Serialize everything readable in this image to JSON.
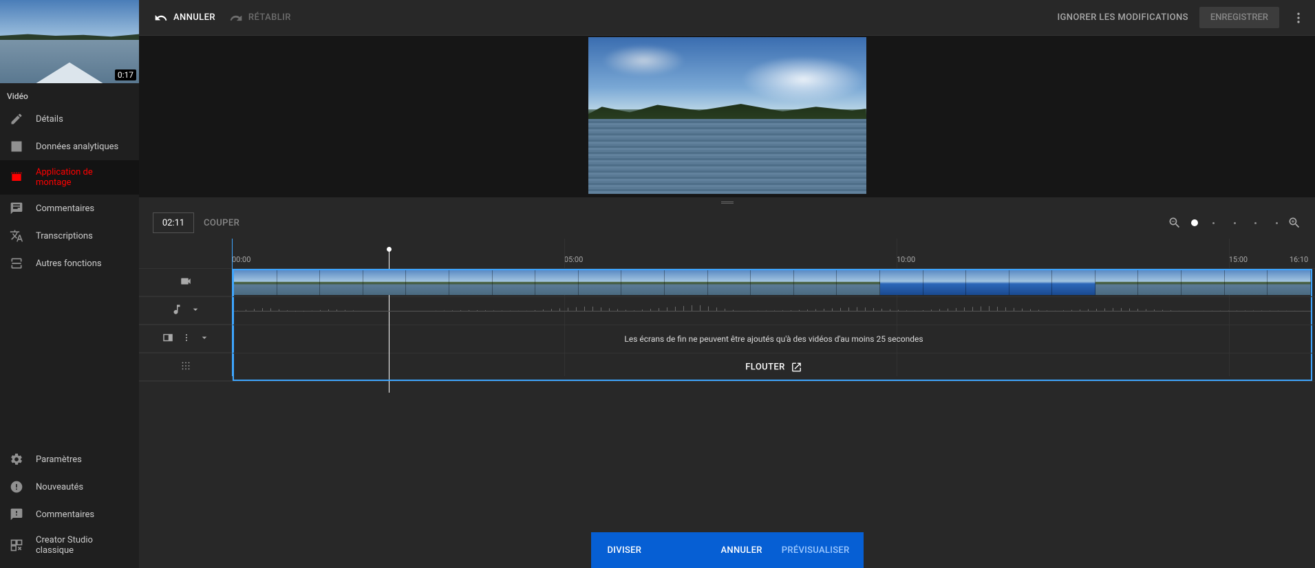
{
  "thumbnail": {
    "duration": "0:17"
  },
  "sidebar": {
    "section_label": "Vidéo",
    "items": [
      {
        "label": "Détails"
      },
      {
        "label": "Données analytiques"
      },
      {
        "label": "Application de montage"
      },
      {
        "label": "Commentaires"
      },
      {
        "label": "Transcriptions"
      },
      {
        "label": "Autres fonctions"
      }
    ],
    "bottom": [
      {
        "label": "Paramètres"
      },
      {
        "label": "Nouveautés"
      },
      {
        "label": "Commentaires"
      },
      {
        "label": "Creator Studio classique"
      }
    ]
  },
  "topbar": {
    "undo": "ANNULER",
    "redo": "RÉTABLIR",
    "discard": "IGNORER LES MODIFICATIONS",
    "save": "ENREGISTRER"
  },
  "controls": {
    "timecode": "02:11",
    "cut": "COUPER"
  },
  "ruler": {
    "marks": [
      "00:00",
      "05:00",
      "10:00",
      "15:00",
      "16:10"
    ]
  },
  "tracks": {
    "end_screen_msg": "Les écrans de fin ne peuvent être ajoutés qu'à des vidéos d'au moins 25 secondes",
    "blur": "FLOUTER"
  },
  "actionbar": {
    "split": "DIVISER",
    "cancel": "ANNULER",
    "preview": "PRÉVISUALISER"
  }
}
